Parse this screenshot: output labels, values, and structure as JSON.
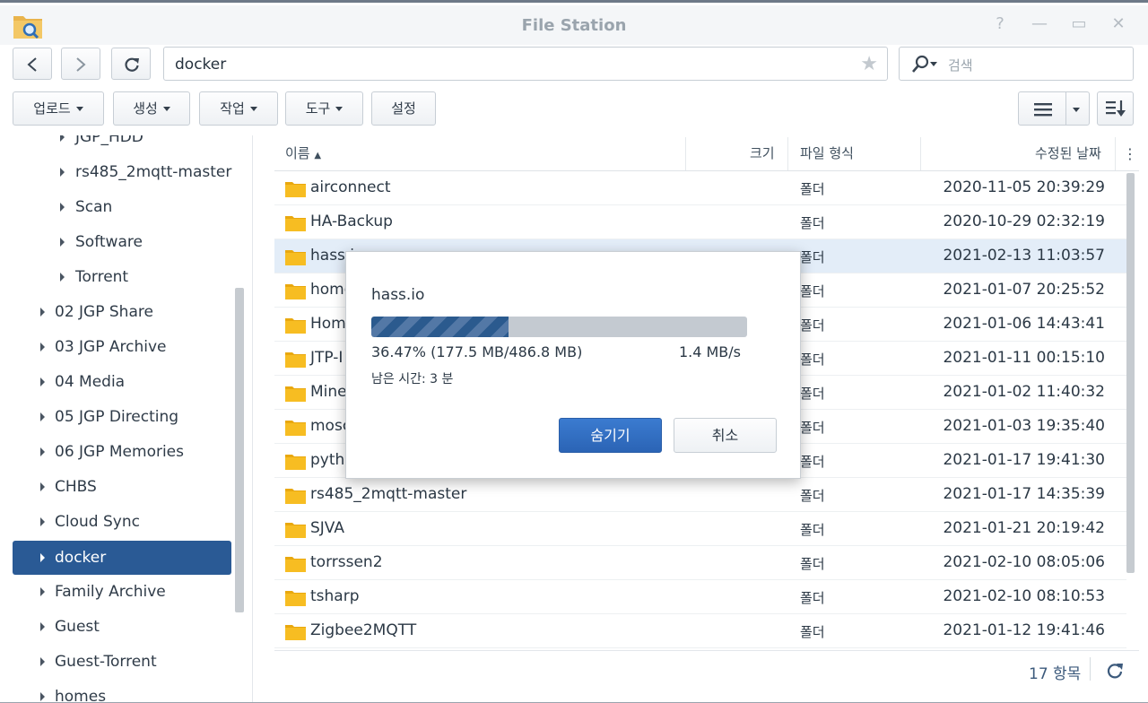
{
  "window": {
    "title": "File Station"
  },
  "nav": {
    "path": "docker",
    "search_placeholder": "검색"
  },
  "toolbar": {
    "upload": "업로드",
    "create": "생성",
    "action": "작업",
    "tools": "도구",
    "settings": "설정"
  },
  "sidebar": {
    "items": [
      {
        "label": "JGP_HDD"
      },
      {
        "label": "rs485_2mqtt-master"
      },
      {
        "label": "Scan"
      },
      {
        "label": "Software"
      },
      {
        "label": "Torrent"
      },
      {
        "label": "02 JGP Share"
      },
      {
        "label": "03 JGP Archive"
      },
      {
        "label": "04 Media"
      },
      {
        "label": "05 JGP Directing"
      },
      {
        "label": "06 JGP Memories"
      },
      {
        "label": "CHBS"
      },
      {
        "label": "Cloud Sync"
      },
      {
        "label": "docker"
      },
      {
        "label": "Family Archive"
      },
      {
        "label": "Guest"
      },
      {
        "label": "Guest-Torrent"
      },
      {
        "label": "homes"
      }
    ]
  },
  "columns": {
    "name": "이름",
    "size": "크기",
    "type": "파일 형식",
    "modified": "수정된 날짜"
  },
  "files": [
    {
      "name": "airconnect",
      "type": "폴더",
      "date": "2020-11-05 20:39:29"
    },
    {
      "name": "HA-Backup",
      "type": "폴더",
      "date": "2020-10-29 02:32:19"
    },
    {
      "name": "hass.io",
      "type": "폴더",
      "date": "2021-02-13 11:03:57"
    },
    {
      "name": "home",
      "type": "폴더",
      "date": "2021-01-07 20:25:52"
    },
    {
      "name": "Hom",
      "type": "폴더",
      "date": "2021-01-06 14:43:41"
    },
    {
      "name": "JTP-I",
      "type": "폴더",
      "date": "2021-01-11 00:15:10"
    },
    {
      "name": "Mine",
      "type": "폴더",
      "date": "2021-01-02 11:40:32"
    },
    {
      "name": "mosc",
      "type": "폴더",
      "date": "2021-01-03 19:35:40"
    },
    {
      "name": "pyth",
      "type": "폴더",
      "date": "2021-01-17 19:41:30"
    },
    {
      "name": "rs485_2mqtt-master",
      "type": "폴더",
      "date": "2021-01-17 14:35:39"
    },
    {
      "name": "SJVA",
      "type": "폴더",
      "date": "2021-01-21 20:19:42"
    },
    {
      "name": "torrssen2",
      "type": "폴더",
      "date": "2021-02-10 08:05:06"
    },
    {
      "name": "tsharp",
      "type": "폴더",
      "date": "2021-02-10 08:10:53"
    },
    {
      "name": "Zigbee2MQTT",
      "type": "폴더",
      "date": "2021-01-12 19:41:46"
    }
  ],
  "footer": {
    "count": "17 항목"
  },
  "dialog": {
    "title": "hass.io",
    "progress_percent": 36.47,
    "stats": "36.47% (177.5 MB/486.8 MB)",
    "speed": "1.4 MB/s",
    "remaining": "남은 시간: 3 분",
    "hide_label": "숨기기",
    "cancel_label": "취소"
  },
  "colors": {
    "accent": "#2a5a95",
    "folder": "#f5b316",
    "selected_row": "#e3edf8"
  }
}
